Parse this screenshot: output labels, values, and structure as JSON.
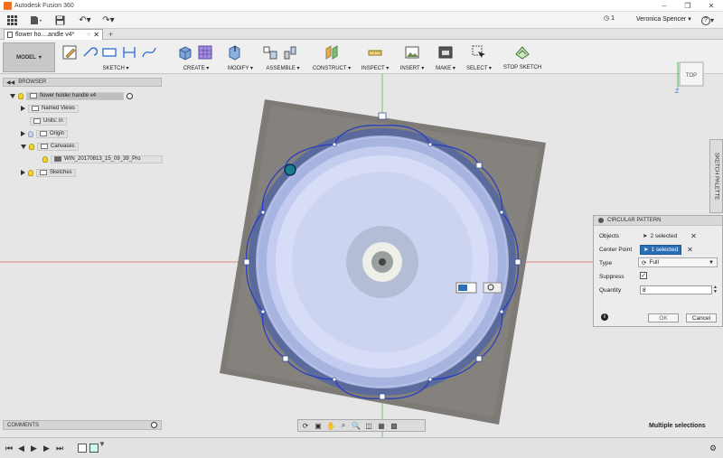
{
  "window": {
    "title": "Autodesk Fusion 360"
  },
  "quickbar": {
    "jobs_count": "1",
    "user": "Veronica Spencer",
    "help": "?"
  },
  "tab": {
    "label": "flower ho....andle v4*"
  },
  "ribbon": {
    "workspace": "MODEL",
    "groups": [
      {
        "label": "SKETCH"
      },
      {
        "label": "CREATE"
      },
      {
        "label": "MODIFY"
      },
      {
        "label": "ASSEMBLE"
      },
      {
        "label": "CONSTRUCT"
      },
      {
        "label": "INSPECT"
      },
      {
        "label": "INSERT"
      },
      {
        "label": "MAKE"
      },
      {
        "label": "SELECT"
      },
      {
        "label": "STOP SKETCH"
      }
    ]
  },
  "browser": {
    "header": "BROWSER",
    "items": [
      {
        "label": "flower holder handle v4"
      },
      {
        "label": "Named Views"
      },
      {
        "label": "Units: in"
      },
      {
        "label": "Origin"
      },
      {
        "label": "Canvases"
      },
      {
        "label": "WIN_20170813_15_09_39_Pro"
      },
      {
        "label": "Sketches"
      }
    ]
  },
  "viewcube": {
    "face": "TOP",
    "axis_z": "Z",
    "axis_x": "X"
  },
  "palette_tab": {
    "label": "SKETCH PALETTE"
  },
  "dialog": {
    "title": "CIRCULAR PATTERN",
    "objects_label": "Objects",
    "objects_value": "2 selected",
    "center_label": "Center Point",
    "center_value": "1 selected",
    "type_label": "Type",
    "type_value": "Full",
    "suppress_label": "Suppress",
    "suppress_checked": true,
    "quantity_label": "Quantity",
    "quantity_value": "8",
    "ok": "OK",
    "cancel": "Cancel"
  },
  "comments": {
    "label": "COMMENTS"
  },
  "status": {
    "text": "Multiple selections"
  },
  "colors": {
    "accent": "#2c6eb6",
    "sketch_line": "#2b3fbf",
    "axis_red": "#e06060",
    "axis_green": "#4fc04f"
  }
}
